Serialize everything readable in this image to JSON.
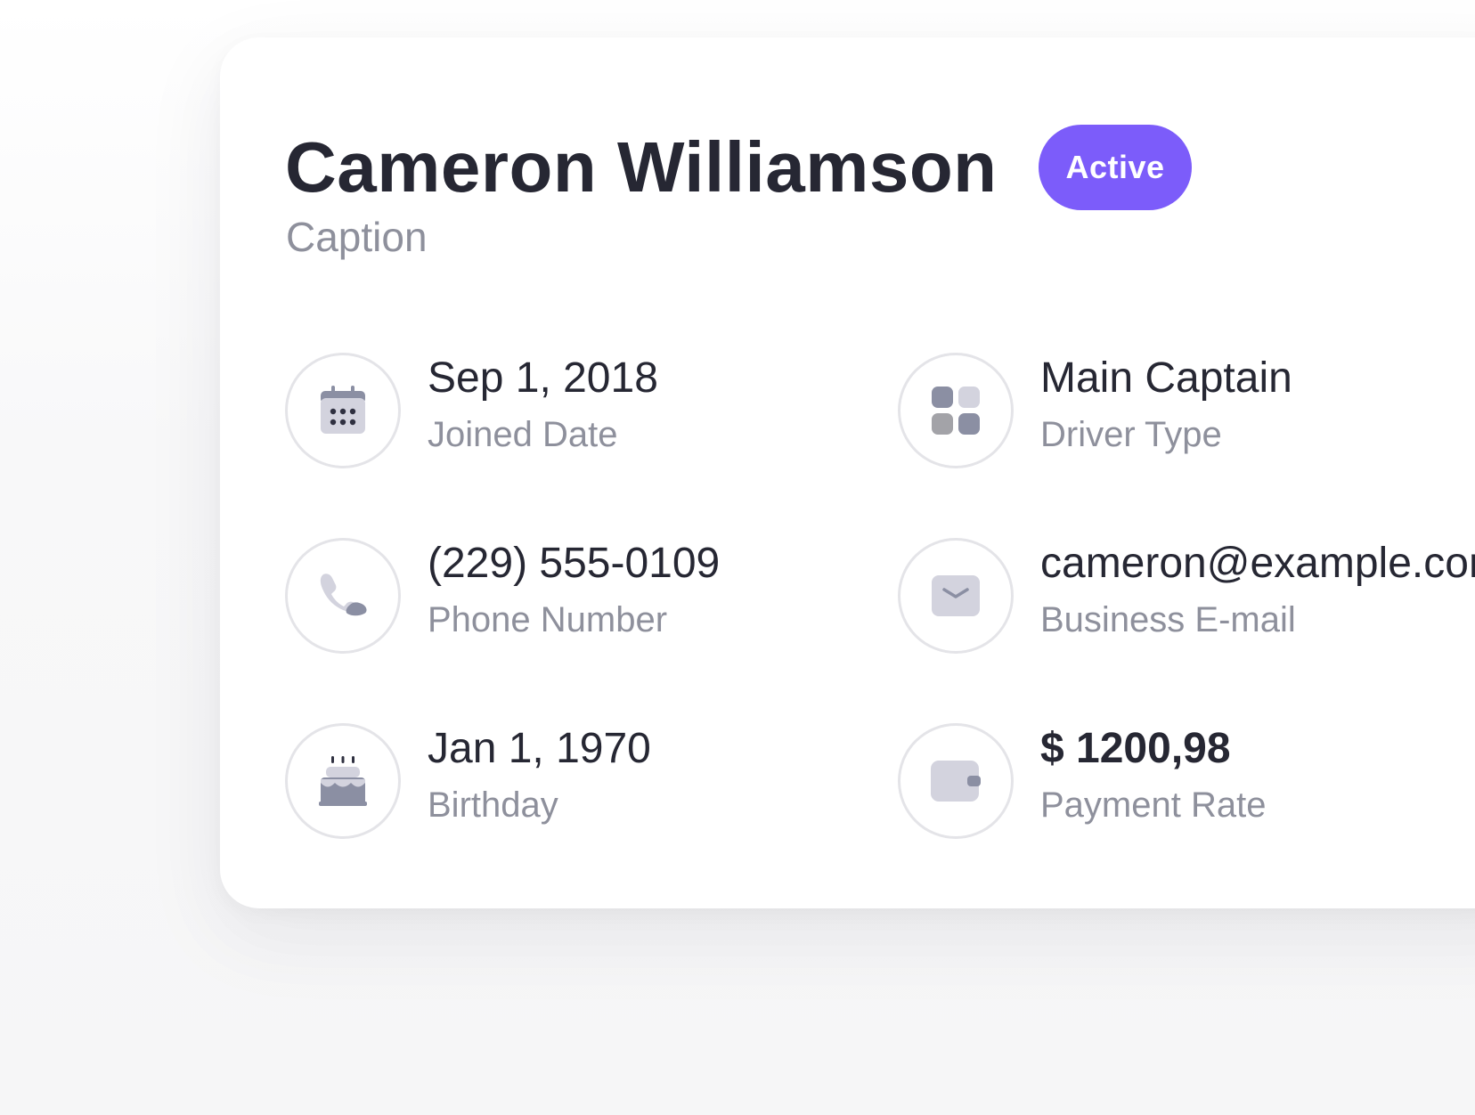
{
  "profile": {
    "name": "Cameron Williamson",
    "caption": "Caption",
    "status": "Active"
  },
  "details": {
    "joined": {
      "value": "Sep 1, 2018",
      "label": "Joined Date",
      "icon": "calendar-icon"
    },
    "driver_type": {
      "value": "Main Captain",
      "label": "Driver Type",
      "icon": "grid-icon"
    },
    "phone": {
      "value": "(229) 555-0109",
      "label": "Phone Number",
      "icon": "phone-icon"
    },
    "email": {
      "value": "cameron@example.com",
      "label": "Business E-mail",
      "icon": "mail-icon"
    },
    "birthday": {
      "value": "Jan 1, 1970",
      "label": "Birthday",
      "icon": "cake-icon"
    },
    "payment": {
      "value": "$ 1200,98",
      "label": "Payment Rate",
      "icon": "wallet-icon"
    }
  },
  "colors": {
    "accent": "#7c5cfa",
    "text_primary": "#262733",
    "text_secondary": "#8e909c",
    "icon_fill": "#d3d3de",
    "icon_dark": "#8b8fa3",
    "circle_border": "#e4e4e8"
  }
}
